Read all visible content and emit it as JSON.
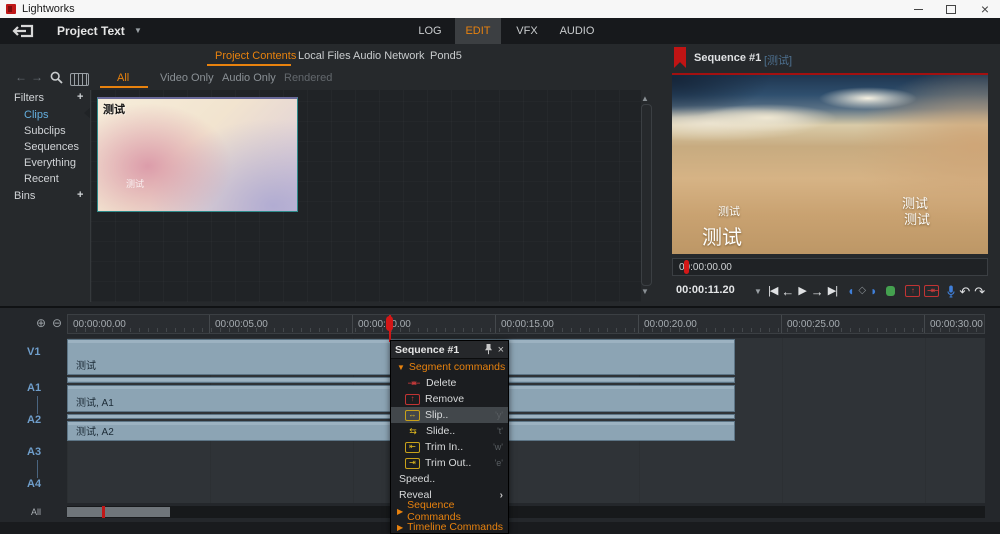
{
  "window": {
    "title": "Lightworks"
  },
  "topbar": {
    "project_name": "Project Text",
    "tabs": [
      {
        "label": "LOG"
      },
      {
        "label": "EDIT"
      },
      {
        "label": "VFX"
      },
      {
        "label": "AUDIO"
      }
    ]
  },
  "content_panel": {
    "tabs": [
      {
        "label": "Project Contents"
      },
      {
        "label": "Local Files"
      },
      {
        "label": "Audio Network"
      },
      {
        "label": "Pond5"
      }
    ],
    "subtabs": [
      {
        "label": "All"
      },
      {
        "label": "Video Only"
      },
      {
        "label": "Audio Only"
      },
      {
        "label": "Rendered"
      }
    ],
    "filters": {
      "header": "Filters",
      "add": "+",
      "items": [
        {
          "label": "Clips"
        },
        {
          "label": "Subclips"
        },
        {
          "label": "Sequences"
        },
        {
          "label": "Everything"
        },
        {
          "label": "Recent"
        }
      ],
      "bins_header": "Bins"
    },
    "thumbnail": {
      "title": "测试",
      "watermark": "测试"
    }
  },
  "viewer": {
    "title": "Sequence #1",
    "tag": "[测试]",
    "overlays": {
      "left_small": "测试",
      "left_large": "测试",
      "right_line1": "测试",
      "right_line2": "测试"
    },
    "scrub_timecode": "00:00:00.00",
    "timecode": "00:00:11.20"
  },
  "timeline": {
    "ruler_labels": [
      "00:00:00.00",
      "00:00:05.00",
      "00:00:10.00",
      "00:00:15.00",
      "00:00:20.00",
      "00:00:25.00",
      "00:00:30.00"
    ],
    "tracks": [
      {
        "label": "V1"
      },
      {
        "label": "A1"
      },
      {
        "label": "A2"
      },
      {
        "label": "A3"
      },
      {
        "label": "A4"
      }
    ],
    "clips": [
      {
        "label": "测试"
      },
      {
        "label": "测试, A1"
      },
      {
        "label": "测试, A2"
      }
    ],
    "all_label": "All"
  },
  "context_menu": {
    "title": "Sequence #1",
    "section": "Segment commands",
    "items": [
      {
        "label": "Delete",
        "shortcut": ""
      },
      {
        "label": "Remove",
        "shortcut": ""
      },
      {
        "label": "Slip..",
        "shortcut": "'y'"
      },
      {
        "label": "Slide..",
        "shortcut": "'t'"
      },
      {
        "label": "Trim In..",
        "shortcut": "'w'"
      },
      {
        "label": "Trim Out..",
        "shortcut": "'e'"
      },
      {
        "label": "Speed..",
        "shortcut": ""
      },
      {
        "label": "Reveal",
        "shortcut": ""
      }
    ],
    "collapsed_sections": [
      {
        "label": "Sequence Commands"
      },
      {
        "label": "Timeline Commands"
      }
    ]
  },
  "icons": {
    "caret_down": "▼",
    "caret_right": "▶",
    "submenu_arrow": "›",
    "back_arrow": "←",
    "forward_arrow": "→",
    "jump_start": "|◀",
    "step_back": "←",
    "play": "▶",
    "step_forward": "→",
    "jump_end": "▶|",
    "mark_in": "◖",
    "mark_point": "◇",
    "mark_out": "◗",
    "undo": "↶",
    "redo": "↷",
    "zoom_in": "⊕",
    "zoom_out": "⊖",
    "scroll_up": "▲",
    "scroll_down": "▼",
    "delete": "⇥⇤",
    "remove": "↑",
    "slip": "↔",
    "slide": "⇆",
    "trim_in": "⇤",
    "trim_out": "⇥",
    "minimize": "",
    "maximize": "",
    "close": "×"
  },
  "colors": {
    "accent": "#e8820e",
    "playhead": "#d41717",
    "clip": "#8ca4b4",
    "selected_filter": "#63aede"
  }
}
